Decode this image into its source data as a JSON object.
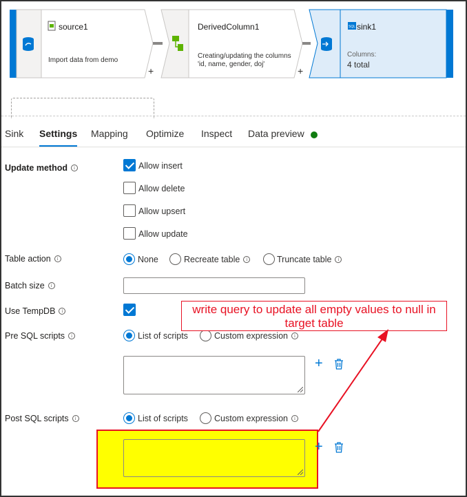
{
  "pipeline": {
    "nodes": [
      {
        "title": "source1",
        "description": "Import data from demo",
        "icon": "source-dataset-icon"
      },
      {
        "title": "DerivedColumn1",
        "description": "Creating/updating the columns 'id, name, gender, doj'",
        "icon": "derived-column-icon"
      },
      {
        "title": "sink1",
        "columns_label": "Columns:",
        "columns_value": "4 total",
        "icon": "sql-sink-icon"
      }
    ],
    "plus": "+"
  },
  "tabs": [
    "Sink",
    "Settings",
    "Mapping",
    "Optimize",
    "Inspect",
    "Data preview"
  ],
  "active_tab": "Settings",
  "form": {
    "update_method": {
      "label": "Update method",
      "options": [
        {
          "label": "Allow insert",
          "checked": true
        },
        {
          "label": "Allow delete",
          "checked": false
        },
        {
          "label": "Allow upsert",
          "checked": false
        },
        {
          "label": "Allow update",
          "checked": false
        }
      ]
    },
    "table_action": {
      "label": "Table action",
      "options": [
        "None",
        "Recreate table",
        "Truncate table"
      ],
      "selected": "None"
    },
    "batch_size": {
      "label": "Batch size",
      "value": ""
    },
    "use_tempdb": {
      "label": "Use TempDB",
      "checked": true
    },
    "pre_sql": {
      "label": "Pre SQL scripts",
      "options": [
        "List of scripts",
        "Custom expression"
      ],
      "selected": "List of scripts",
      "value": ""
    },
    "post_sql": {
      "label": "Post SQL scripts",
      "options": [
        "List of scripts",
        "Custom expression"
      ],
      "selected": "List of scripts",
      "value": ""
    }
  },
  "annotation": {
    "text": "write query to update all empty values to null in target table",
    "color": "#e81123",
    "highlight_color": "#ffff00"
  },
  "colors": {
    "accent": "#0078d4",
    "status_ok": "#107c10",
    "sink_bg": "#deecf9"
  }
}
